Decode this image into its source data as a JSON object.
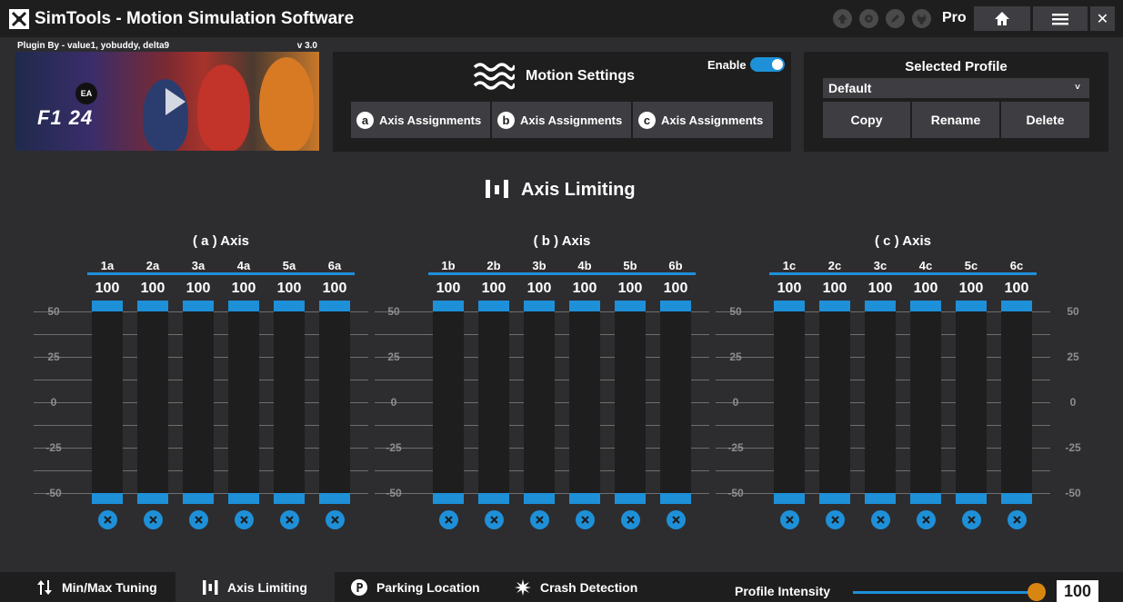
{
  "app": {
    "title": "SimTools - Motion Simulation Software",
    "edition": "Pro",
    "title_icons": [
      "up-arrow-icon",
      "gear-badge-icon",
      "pencil-icon",
      "power-plug-icon"
    ],
    "buttons": [
      "home-icon",
      "menu-icon",
      "close-icon"
    ],
    "close_glyph": "✕"
  },
  "plugin": {
    "credit": "Plugin By - value1, yobuddy, delta9",
    "version": "v 3.0",
    "image_text": "F1 24",
    "image_badge": "EA"
  },
  "motion": {
    "title": "Motion Settings",
    "enable_label": "Enable",
    "enabled": true,
    "axis_buttons": [
      {
        "letter": "a",
        "label": "Axis Assignments"
      },
      {
        "letter": "b",
        "label": "Axis Assignments"
      },
      {
        "letter": "c",
        "label": "Axis Assignments"
      }
    ]
  },
  "profile": {
    "title": "Selected Profile",
    "selected": "Default",
    "chevron": "˅",
    "buttons": [
      "Copy",
      "Rename",
      "Delete"
    ]
  },
  "section": {
    "title": "Axis Limiting"
  },
  "scale_ticks": [
    "50",
    "25",
    "0",
    "-25",
    "-50"
  ],
  "groups": [
    {
      "title": "( a ) Axis",
      "columns": [
        {
          "label": "1a",
          "value": "100"
        },
        {
          "label": "2a",
          "value": "100"
        },
        {
          "label": "3a",
          "value": "100"
        },
        {
          "label": "4a",
          "value": "100"
        },
        {
          "label": "5a",
          "value": "100"
        },
        {
          "label": "6a",
          "value": "100"
        }
      ]
    },
    {
      "title": "( b ) Axis",
      "columns": [
        {
          "label": "1b",
          "value": "100"
        },
        {
          "label": "2b",
          "value": "100"
        },
        {
          "label": "3b",
          "value": "100"
        },
        {
          "label": "4b",
          "value": "100"
        },
        {
          "label": "5b",
          "value": "100"
        },
        {
          "label": "6b",
          "value": "100"
        }
      ]
    },
    {
      "title": "( c ) Axis",
      "columns": [
        {
          "label": "1c",
          "value": "100"
        },
        {
          "label": "2c",
          "value": "100"
        },
        {
          "label": "3c",
          "value": "100"
        },
        {
          "label": "4c",
          "value": "100"
        },
        {
          "label": "5c",
          "value": "100"
        },
        {
          "label": "6c",
          "value": "100"
        }
      ]
    }
  ],
  "bottom_tabs": [
    {
      "label": "Min/Max Tuning",
      "icon": "up-down-arrows-icon",
      "active": false
    },
    {
      "label": "Axis Limiting",
      "icon": "bars-icon",
      "active": true
    },
    {
      "label": "Parking Location",
      "icon": "parking-icon",
      "active": false
    },
    {
      "label": "Crash Detection",
      "icon": "crash-burst-icon",
      "active": false
    }
  ],
  "intensity": {
    "label": "Profile Intensity",
    "value": "100",
    "level_percent": 100
  },
  "colors": {
    "accent": "#1e90d8",
    "panel": "#1e1e1e",
    "background": "#2d2d30",
    "button": "#3e3e42",
    "knob": "#d98512"
  }
}
